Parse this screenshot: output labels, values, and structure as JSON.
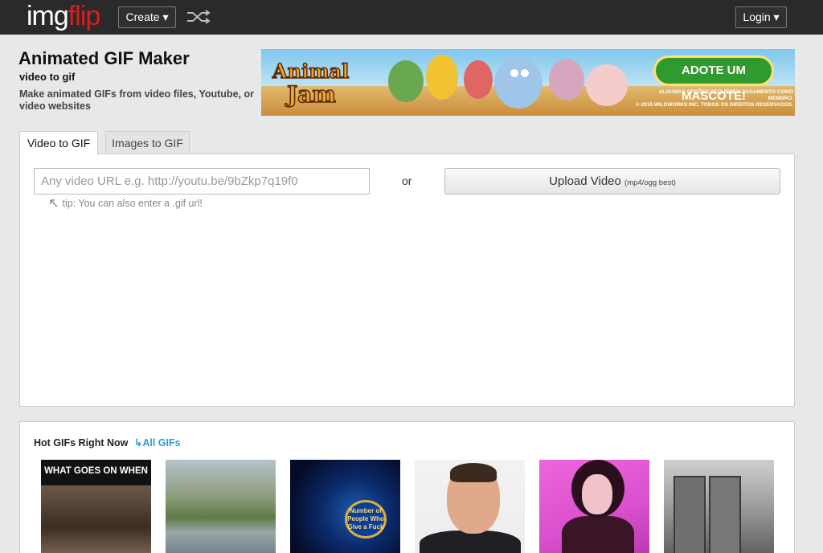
{
  "nav": {
    "logo_img": "img",
    "logo_flip": "flip",
    "create_label": "Create ▾",
    "login_label": "Login ▾"
  },
  "header": {
    "title": "Animated GIF Maker",
    "subtitle": "video to gif",
    "description": "Make animated GIFs from video files, Youtube, or video websites"
  },
  "ad": {
    "cta": "ADOTE UM MASCOTE!",
    "fine_print_1": "ALGUMAS OPÇÕES REQUEREM PAGAMENTO COMO MEMBRO.",
    "fine_print_2": "© 2015 WILDWORKS INC. TODOS OS DIREITOS RESERVADOS."
  },
  "tabs": [
    {
      "label": "Video to GIF",
      "active": true
    },
    {
      "label": "Images to GIF",
      "active": false
    }
  ],
  "form": {
    "url_placeholder": "Any video URL e.g. http://youtu.be/9bZkp7q19f0",
    "or_text": "or",
    "upload_label": "Upload Video",
    "upload_hint": "(mp4/ogg best)",
    "tip": "tip: You can also enter a .gif url!"
  },
  "hot": {
    "title": "Hot GIFs Right Now",
    "all_link": "All GIFs",
    "thumbs": [
      {
        "caption": "WHAT GOES ON WHEN"
      },
      {
        "caption": ""
      },
      {
        "caption": "Number of People Who Give a Fuck"
      },
      {
        "caption": ""
      },
      {
        "caption": ""
      },
      {
        "caption": ""
      }
    ]
  },
  "colors": {
    "topbar": "#2a2a2a",
    "logo_accent": "#d91d1d",
    "link": "#2a9fd6",
    "background": "#e8e8e8"
  }
}
